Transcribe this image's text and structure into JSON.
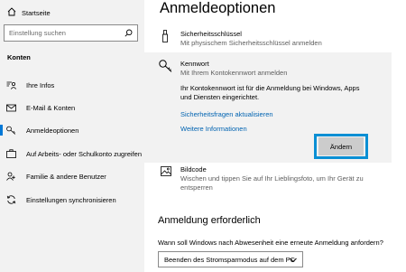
{
  "sidebar": {
    "home_label": "Startseite",
    "search_placeholder": "Einstellung suchen",
    "section_title": "Konten",
    "items": [
      {
        "label": "Ihre Infos",
        "icon": "person-card-icon"
      },
      {
        "label": "E-Mail & Konten",
        "icon": "mail-icon"
      },
      {
        "label": "Anmeldeoptionen",
        "icon": "key-icon",
        "active": true
      },
      {
        "label": "Auf Arbeits- oder Schulkonto zugreifen",
        "icon": "briefcase-icon"
      },
      {
        "label": "Familie & andere Benutzer",
        "icon": "people-icon"
      },
      {
        "label": "Einstellungen synchronisieren",
        "icon": "sync-icon"
      }
    ]
  },
  "main": {
    "title": "Anmeldeoptionen",
    "security_key": {
      "title": "Sicherheitsschlüssel",
      "subtitle": "Mit physischem Sicherheitsschlüssel anmelden"
    },
    "password": {
      "title": "Kennwort",
      "subtitle": "Mit Ihrem Kontokennwort anmelden",
      "body_line1": "Ihr Kontokennwort ist für die Anmeldung bei Windows, Apps",
      "body_line2": "und Diensten eingerichtet.",
      "link1": "Sicherheitsfragen aktualisieren",
      "link2": "Weitere Informationen",
      "button": "Ändern"
    },
    "picture": {
      "title": "Bildcode",
      "subtitle_line1": "Wischen und tippen Sie auf Ihr Lieblingsfoto, um Ihr Gerät zu",
      "subtitle_line2": "entsperren"
    },
    "signin_required": {
      "heading": "Anmeldung erforderlich",
      "question": "Wann soll Windows nach Abwesenheit eine erneute Anmeldung anfordern?",
      "selected": "Beenden des Stromsparmodus auf dem PC"
    }
  },
  "colors": {
    "accent": "#0078d7",
    "link": "#0063b1",
    "highlight": "#0a8fd4"
  }
}
